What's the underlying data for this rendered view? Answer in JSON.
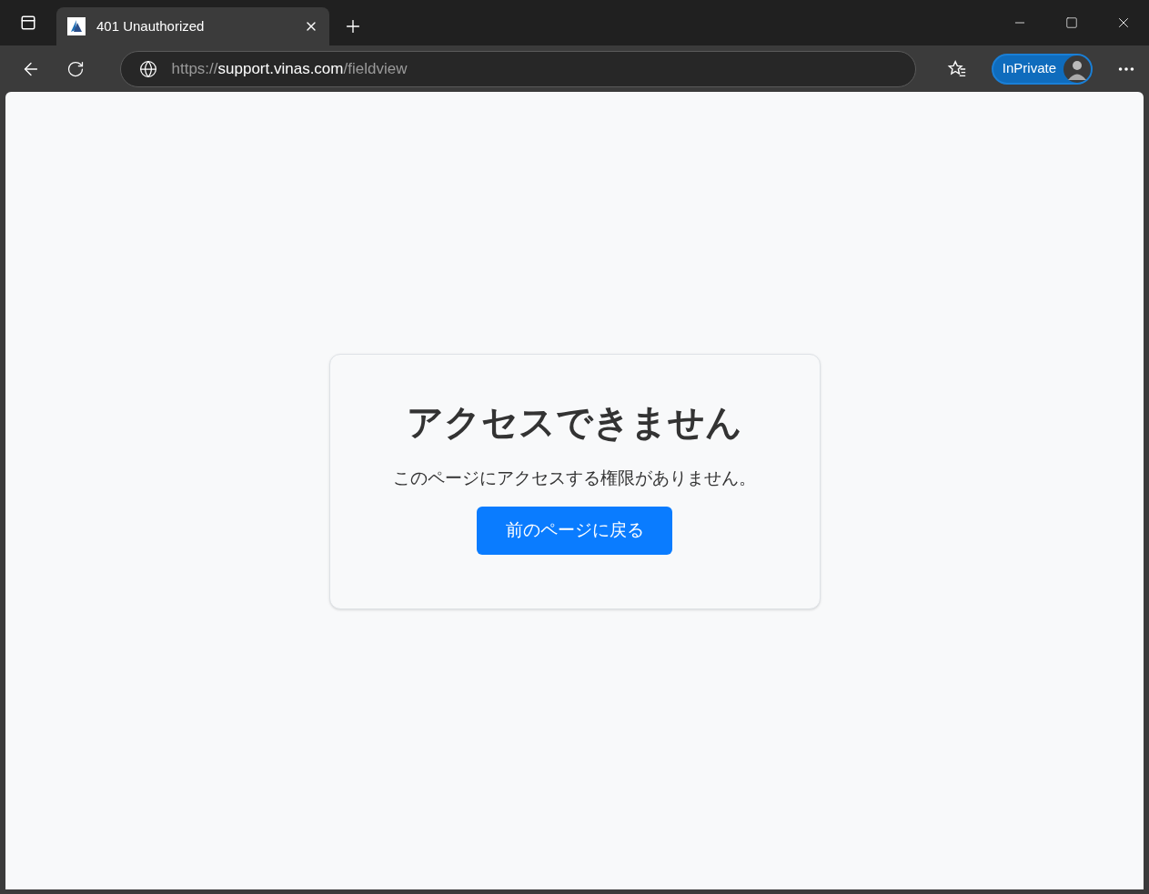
{
  "tab": {
    "title": "401 Unauthorized",
    "selected": true
  },
  "address_bar": {
    "url_parts": [
      {
        "kind": "dim",
        "text": "https://"
      },
      {
        "kind": "bright",
        "text": "support.vinas.com"
      },
      {
        "kind": "dim",
        "text": "/fieldview"
      }
    ]
  },
  "profile": {
    "label": "InPrivate"
  },
  "card": {
    "title": "アクセスできません",
    "message": "このページにアクセスする権限がありません。",
    "button": "前のページに戻る"
  }
}
